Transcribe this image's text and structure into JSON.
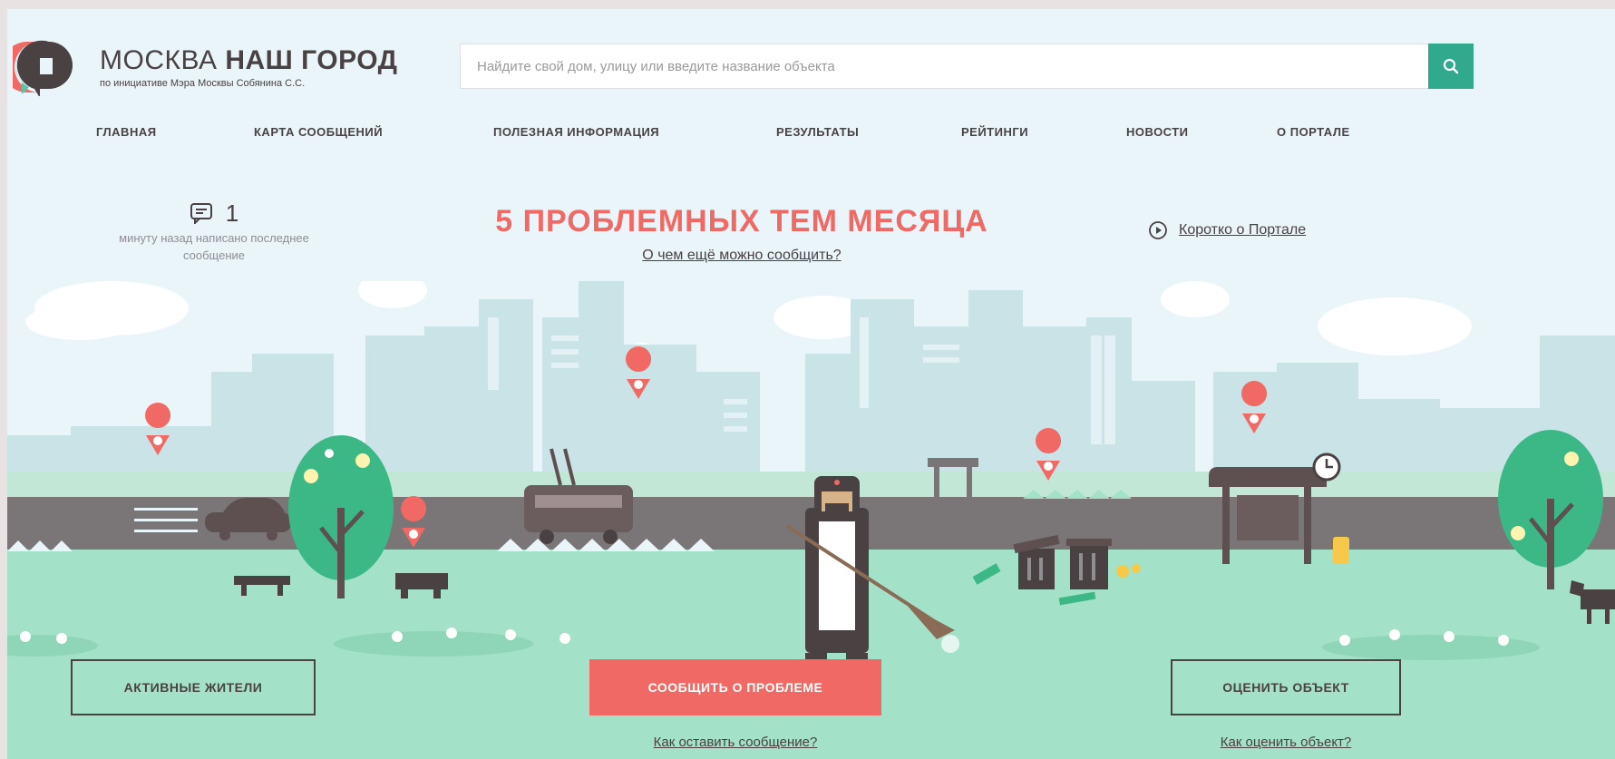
{
  "logo": {
    "title_light": "МОСКВА",
    "title_bold": "НАШ ГОРОД",
    "subtitle": "по инициативе Мэра Москвы Собянина С.С."
  },
  "search": {
    "placeholder": "Найдите свой дом, улицу или введите название объекта",
    "value": ""
  },
  "nav": {
    "items": [
      {
        "label": "ГЛАВНАЯ"
      },
      {
        "label": "КАРТА СООБЩЕНИЙ"
      },
      {
        "label": "ПОЛЕЗНАЯ ИНФОРМАЦИЯ"
      },
      {
        "label": "РЕЗУЛЬТАТЫ"
      },
      {
        "label": "РЕЙТИНГИ"
      },
      {
        "label": "НОВОСТИ"
      },
      {
        "label": "О ПОРТАЛЕ"
      }
    ]
  },
  "counter": {
    "count": "1",
    "text": "минуту назад написано последнее сообщение"
  },
  "hero": {
    "title": "5 ПРОБЛЕМНЫХ ТЕМ МЕСЯЦА",
    "link": "О чем ещё можно сообщить?"
  },
  "portal_link": "Коротко о Портале",
  "actions": {
    "active_residents": "АКТИВНЫЕ ЖИТЕЛИ",
    "report_problem": "СООБЩИТЬ О ПРОБЛЕМЕ",
    "report_help": "Как оставить сообщение?",
    "rate_object": "ОЦЕНИТЬ ОБЪЕКТ",
    "rate_help": "Как оценить объект?"
  },
  "colors": {
    "accent": "#f06964",
    "brand_green": "#30a98d",
    "text_dark": "#4a4143",
    "grass": "#a3e2c8",
    "road": "#7a7576",
    "buildings": "#c9e3e6"
  }
}
